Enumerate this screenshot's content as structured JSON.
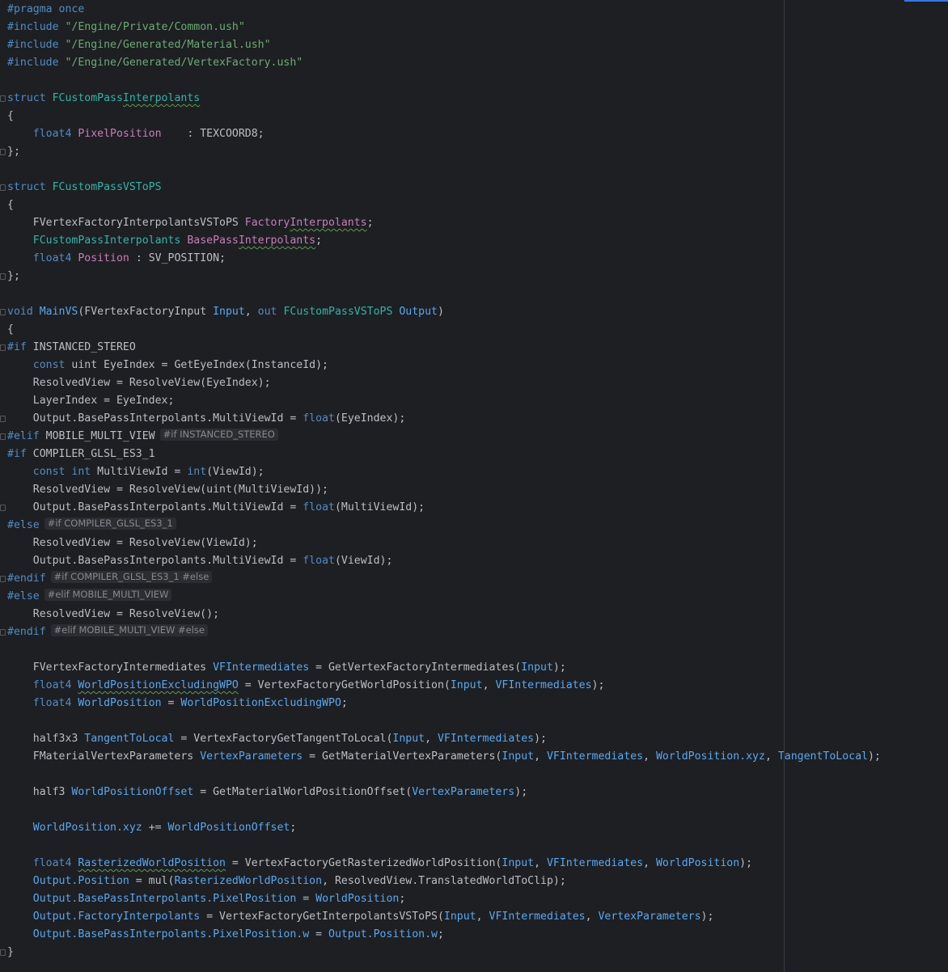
{
  "editor": {
    "language": "HLSL",
    "lines": [
      [
        {
          "t": "#pragma once",
          "c": "directive"
        }
      ],
      [
        {
          "t": "#include ",
          "c": "directive"
        },
        {
          "t": "\"/Engine/Private/Common.ush\"",
          "c": "string"
        }
      ],
      [
        {
          "t": "#include ",
          "c": "directive"
        },
        {
          "t": "\"/Engine/Generated/Material.ush\"",
          "c": "string"
        }
      ],
      [
        {
          "t": "#include ",
          "c": "directive"
        },
        {
          "t": "\"/Engine/Generated/VertexFactory.ush\"",
          "c": "string"
        }
      ],
      [],
      [
        {
          "t": "struct ",
          "c": "kwtype"
        },
        {
          "t": "FCustomPass",
          "c": "typename"
        },
        {
          "t": "Interpolants",
          "c": "typename",
          "s": true
        }
      ],
      [
        {
          "t": "{",
          "c": "plain"
        }
      ],
      [
        {
          "t": "    float4 ",
          "c": "kwtype"
        },
        {
          "t": "PixelPosition",
          "c": "field"
        },
        {
          "t": "    : TEXCOORD8;",
          "c": "plain"
        }
      ],
      [
        {
          "t": "};",
          "c": "plain"
        }
      ],
      [],
      [
        {
          "t": "struct ",
          "c": "kwtype"
        },
        {
          "t": "FCustomPassVSToPS",
          "c": "typename"
        }
      ],
      [
        {
          "t": "{",
          "c": "plain"
        }
      ],
      [
        {
          "t": "    FVertexFactoryInterpolantsVSToPS ",
          "c": "plain"
        },
        {
          "t": "Factory",
          "c": "field"
        },
        {
          "t": "Interpolants",
          "c": "field",
          "s": true
        },
        {
          "t": ";",
          "c": "plain"
        }
      ],
      [
        {
          "t": "    FCustomPassInterpolants ",
          "c": "typename"
        },
        {
          "t": "BasePass",
          "c": "field"
        },
        {
          "t": "Interpolants",
          "c": "field",
          "s": true
        },
        {
          "t": ";",
          "c": "plain"
        }
      ],
      [
        {
          "t": "    float4 ",
          "c": "kwtype"
        },
        {
          "t": "Position",
          "c": "field"
        },
        {
          "t": " : SV_POSITION;",
          "c": "plain"
        }
      ],
      [
        {
          "t": "};",
          "c": "plain"
        }
      ],
      [],
      [
        {
          "t": "void ",
          "c": "kwtype"
        },
        {
          "t": "MainVS",
          "c": "func"
        },
        {
          "t": "(FVertexFactoryInput ",
          "c": "plain"
        },
        {
          "t": "Input",
          "c": "param"
        },
        {
          "t": ", ",
          "c": "plain"
        },
        {
          "t": "out ",
          "c": "kwtype"
        },
        {
          "t": "FCustomPassVSToPS ",
          "c": "typename"
        },
        {
          "t": "Output",
          "c": "param"
        },
        {
          "t": ")",
          "c": "plain"
        }
      ],
      [
        {
          "t": "{",
          "c": "plain"
        }
      ],
      [
        {
          "t": "#if ",
          "c": "directive"
        },
        {
          "t": "INSTANCED_STEREO",
          "c": "macro"
        }
      ],
      [
        {
          "t": "    const ",
          "c": "kwtype"
        },
        {
          "t": "uint EyeIndex = GetEyeIndex(InstanceId);",
          "c": "plain"
        }
      ],
      [
        {
          "t": "    ResolvedView = ResolveView(EyeIndex);",
          "c": "plain"
        }
      ],
      [
        {
          "t": "    LayerIndex = EyeIndex;",
          "c": "plain"
        }
      ],
      [
        {
          "t": "    Output.BasePassInterpolants.MultiViewId = ",
          "c": "plain"
        },
        {
          "t": "float",
          "c": "kwtype"
        },
        {
          "t": "(EyeIndex);",
          "c": "plain"
        }
      ],
      [
        {
          "t": "#elif ",
          "c": "directive"
        },
        {
          "t": "MOBILE_MULTI_VIEW",
          "c": "macro"
        },
        {
          "t": "#if INSTANCED_STEREO",
          "c": "hint"
        }
      ],
      [
        {
          "t": "#if ",
          "c": "directive"
        },
        {
          "t": "COMPILER_GLSL_ES3_1",
          "c": "macro"
        }
      ],
      [
        {
          "t": "    const int ",
          "c": "kwtype"
        },
        {
          "t": "MultiViewId = ",
          "c": "plain"
        },
        {
          "t": "int",
          "c": "kwtype"
        },
        {
          "t": "(ViewId);",
          "c": "plain"
        }
      ],
      [
        {
          "t": "    ResolvedView = ResolveView(uint(MultiViewId));",
          "c": "plain"
        }
      ],
      [
        {
          "t": "    Output.BasePassInterpolants.MultiViewId = ",
          "c": "plain"
        },
        {
          "t": "float",
          "c": "kwtype"
        },
        {
          "t": "(MultiViewId);",
          "c": "plain"
        }
      ],
      [
        {
          "t": "#else",
          "c": "directive"
        },
        {
          "t": "#if COMPILER_GLSL_ES3_1",
          "c": "hint"
        }
      ],
      [
        {
          "t": "    ResolvedView = ResolveView(ViewId);",
          "c": "plain"
        }
      ],
      [
        {
          "t": "    Output.BasePassInterpolants.MultiViewId = ",
          "c": "plain"
        },
        {
          "t": "float",
          "c": "kwtype"
        },
        {
          "t": "(ViewId);",
          "c": "plain"
        }
      ],
      [
        {
          "t": "#endif",
          "c": "directive"
        },
        {
          "t": "#if COMPILER_GLSL_ES3_1 #else",
          "c": "hint"
        }
      ],
      [
        {
          "t": "#else",
          "c": "directive"
        },
        {
          "t": "#elif MOBILE_MULTI_VIEW",
          "c": "hint"
        }
      ],
      [
        {
          "t": "    ResolvedView = ResolveView();",
          "c": "plain"
        }
      ],
      [
        {
          "t": "#endif",
          "c": "directive"
        },
        {
          "t": "#elif MOBILE_MULTI_VIEW #else",
          "c": "hint"
        }
      ],
      [],
      [
        {
          "t": "    FVertexFactoryIntermediates ",
          "c": "plain"
        },
        {
          "t": "VFIntermediates",
          "c": "member"
        },
        {
          "t": " = GetVertexFactoryIntermediates(",
          "c": "plain"
        },
        {
          "t": "Input",
          "c": "member"
        },
        {
          "t": ");",
          "c": "plain"
        }
      ],
      [
        {
          "t": "    float4 ",
          "c": "kwtype"
        },
        {
          "t": "WorldPositionExcludingWPO",
          "c": "member",
          "s": true
        },
        {
          "t": " = VertexFactoryGetWorldPosition(",
          "c": "plain"
        },
        {
          "t": "Input",
          "c": "member"
        },
        {
          "t": ", ",
          "c": "plain"
        },
        {
          "t": "VFIntermediates",
          "c": "member"
        },
        {
          "t": ");",
          "c": "plain"
        }
      ],
      [
        {
          "t": "    float4 ",
          "c": "kwtype"
        },
        {
          "t": "WorldPosition",
          "c": "member"
        },
        {
          "t": " = ",
          "c": "plain"
        },
        {
          "t": "WorldPositionExcludingWPO",
          "c": "member"
        },
        {
          "t": ";",
          "c": "plain"
        }
      ],
      [],
      [
        {
          "t": "    half3x3 ",
          "c": "plain"
        },
        {
          "t": "TangentToLocal",
          "c": "member"
        },
        {
          "t": " = VertexFactoryGetTangentToLocal(",
          "c": "plain"
        },
        {
          "t": "Input",
          "c": "member"
        },
        {
          "t": ", ",
          "c": "plain"
        },
        {
          "t": "VFIntermediates",
          "c": "member"
        },
        {
          "t": ");",
          "c": "plain"
        }
      ],
      [
        {
          "t": "    FMaterialVertexParameters ",
          "c": "plain"
        },
        {
          "t": "VertexParameters",
          "c": "member"
        },
        {
          "t": " = GetMaterialVertexParameters(",
          "c": "plain"
        },
        {
          "t": "Input",
          "c": "member"
        },
        {
          "t": ", ",
          "c": "plain"
        },
        {
          "t": "VFIntermediates",
          "c": "member"
        },
        {
          "t": ", ",
          "c": "plain"
        },
        {
          "t": "WorldPosition.xyz",
          "c": "member"
        },
        {
          "t": ", ",
          "c": "plain"
        },
        {
          "t": "TangentToLocal",
          "c": "member"
        },
        {
          "t": ");",
          "c": "plain"
        }
      ],
      [],
      [
        {
          "t": "    half3 ",
          "c": "plain"
        },
        {
          "t": "WorldPositionOffset",
          "c": "member"
        },
        {
          "t": " = GetMaterialWorldPositionOffset(",
          "c": "plain"
        },
        {
          "t": "VertexParameters",
          "c": "member"
        },
        {
          "t": ");",
          "c": "plain"
        }
      ],
      [],
      [
        {
          "t": "    ",
          "c": "plain"
        },
        {
          "t": "WorldPosition.xyz",
          "c": "member"
        },
        {
          "t": " += ",
          "c": "plain"
        },
        {
          "t": "WorldPositionOffset",
          "c": "member"
        },
        {
          "t": ";",
          "c": "plain"
        }
      ],
      [],
      [
        {
          "t": "    float4 ",
          "c": "kwtype"
        },
        {
          "t": "RasterizedWorldPosition",
          "c": "member",
          "s": true
        },
        {
          "t": " = VertexFactoryGetRasterizedWorldPosition(",
          "c": "plain"
        },
        {
          "t": "Input",
          "c": "member"
        },
        {
          "t": ", ",
          "c": "plain"
        },
        {
          "t": "VFIntermediates",
          "c": "member"
        },
        {
          "t": ", ",
          "c": "plain"
        },
        {
          "t": "WorldPosition",
          "c": "member"
        },
        {
          "t": ");",
          "c": "plain"
        }
      ],
      [
        {
          "t": "    ",
          "c": "plain"
        },
        {
          "t": "Output.Position",
          "c": "member"
        },
        {
          "t": " = mul(",
          "c": "plain"
        },
        {
          "t": "RasterizedWorldPosition",
          "c": "member"
        },
        {
          "t": ", ResolvedView.TranslatedWorldToClip);",
          "c": "plain"
        }
      ],
      [
        {
          "t": "    ",
          "c": "plain"
        },
        {
          "t": "Output.BasePassInterpolants.PixelPosition",
          "c": "member"
        },
        {
          "t": " = ",
          "c": "plain"
        },
        {
          "t": "WorldPosition",
          "c": "member"
        },
        {
          "t": ";",
          "c": "plain"
        }
      ],
      [
        {
          "t": "    ",
          "c": "plain"
        },
        {
          "t": "Output.FactoryInterpolants",
          "c": "member"
        },
        {
          "t": " = VertexFactoryGetInterpolantsVSToPS(",
          "c": "plain"
        },
        {
          "t": "Input",
          "c": "member"
        },
        {
          "t": ", ",
          "c": "plain"
        },
        {
          "t": "VFIntermediates",
          "c": "member"
        },
        {
          "t": ", ",
          "c": "plain"
        },
        {
          "t": "VertexParameters",
          "c": "member"
        },
        {
          "t": ");",
          "c": "plain"
        }
      ],
      [
        {
          "t": "    ",
          "c": "plain"
        },
        {
          "t": "Output.BasePassInterpolants.PixelPosition.w",
          "c": "member"
        },
        {
          "t": " = ",
          "c": "plain"
        },
        {
          "t": "Output.Position.w",
          "c": "member"
        },
        {
          "t": ";",
          "c": "plain"
        }
      ],
      [
        {
          "t": "}",
          "c": "plain"
        }
      ]
    ]
  },
  "colors": {
    "background": "#1e1f22",
    "directive": "#4f8cc9",
    "string": "#6aab73",
    "type": "#2fb5a9",
    "field": "#c77dbb",
    "function": "#56a8f5",
    "text": "#bcbec4",
    "hint_bg": "#2b2d30",
    "squiggle": "#5a9c4e"
  }
}
